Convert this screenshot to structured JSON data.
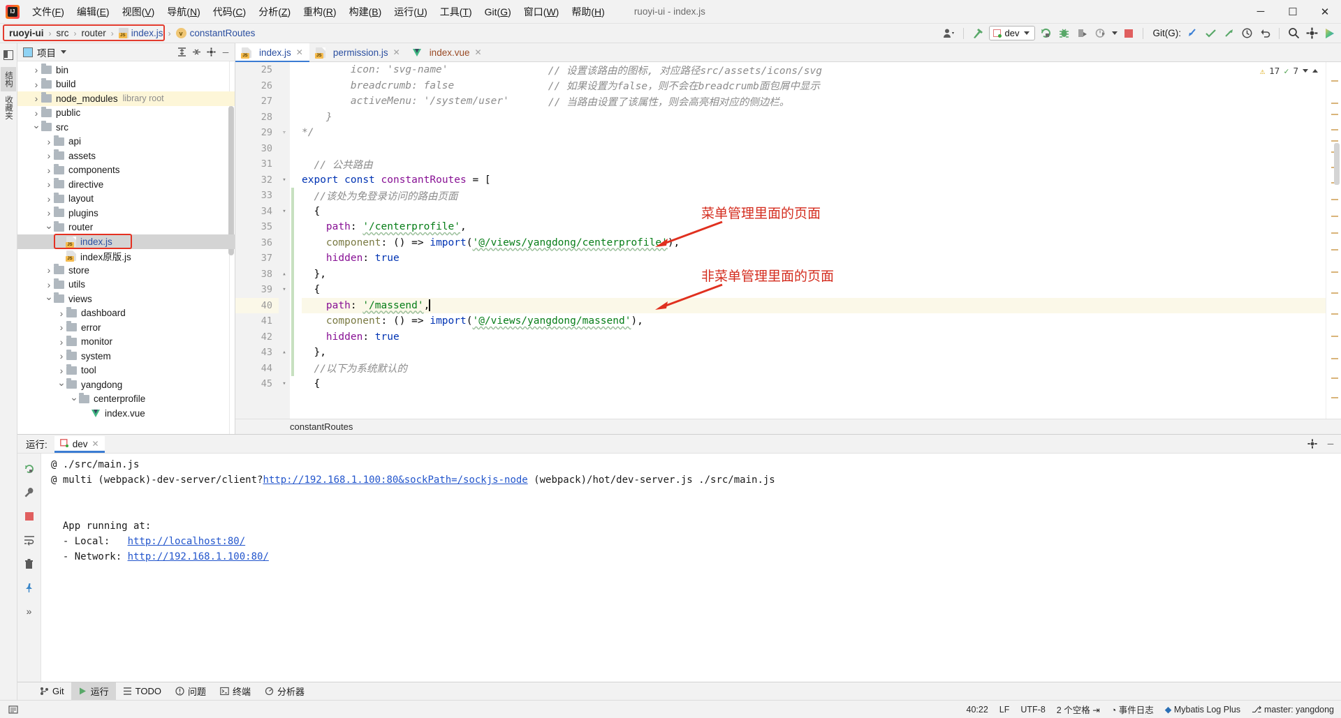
{
  "window": {
    "title": "ruoyi-ui - index.js",
    "minimize": "─",
    "maximize": "☐",
    "close": "✕"
  },
  "menu": [
    "文件(F)",
    "编辑(E)",
    "视图(V)",
    "导航(N)",
    "代码(C)",
    "分析(Z)",
    "重构(R)",
    "构建(B)",
    "运行(U)",
    "工具(T)",
    "Git(G)",
    "窗口(W)",
    "帮助(H)"
  ],
  "breadcrumb": {
    "items": [
      "ruoyi-ui",
      "src",
      "router",
      "index.js",
      "constantRoutes"
    ],
    "separator": "›"
  },
  "toolbar": {
    "run_config": "dev",
    "git_label": "Git(G):",
    "icons": [
      "user-avatar-icon",
      "build-hammer-icon",
      "run-icon",
      "debug-icon",
      "coverage-icon",
      "profile-icon",
      "stop-icon",
      "update-project-icon",
      "commit-icon",
      "push-icon",
      "history-icon",
      "rollback-icon",
      "search-everywhere-icon",
      "settings-icon",
      "idea-services-icon"
    ]
  },
  "left_tool_tabs": [
    "项目",
    "结构收藏夹"
  ],
  "project_panel": {
    "title": "项目",
    "actions": [
      "expand-all-icon",
      "collapse-all-icon",
      "settings-icon",
      "hide-icon"
    ],
    "tree": [
      {
        "label": "bin",
        "type": "folder",
        "indent": 1,
        "arrow": "collapsed",
        "state": ""
      },
      {
        "label": "build",
        "type": "folder",
        "indent": 1,
        "arrow": "collapsed",
        "state": ""
      },
      {
        "label": "node_modules",
        "type": "folder",
        "indent": 1,
        "arrow": "collapsed",
        "state": "yellow",
        "suffix": "library root"
      },
      {
        "label": "public",
        "type": "folder",
        "indent": 1,
        "arrow": "collapsed",
        "state": ""
      },
      {
        "label": "src",
        "type": "folder",
        "indent": 1,
        "arrow": "expanded",
        "state": ""
      },
      {
        "label": "api",
        "type": "folder",
        "indent": 2,
        "arrow": "collapsed",
        "state": ""
      },
      {
        "label": "assets",
        "type": "folder",
        "indent": 2,
        "arrow": "collapsed",
        "state": ""
      },
      {
        "label": "components",
        "type": "folder",
        "indent": 2,
        "arrow": "collapsed",
        "state": ""
      },
      {
        "label": "directive",
        "type": "folder",
        "indent": 2,
        "arrow": "collapsed",
        "state": ""
      },
      {
        "label": "layout",
        "type": "folder",
        "indent": 2,
        "arrow": "collapsed",
        "state": ""
      },
      {
        "label": "plugins",
        "type": "folder",
        "indent": 2,
        "arrow": "collapsed",
        "state": ""
      },
      {
        "label": "router",
        "type": "folder",
        "indent": 2,
        "arrow": "expanded",
        "state": ""
      },
      {
        "label": "index.js",
        "type": "js",
        "indent": 3,
        "arrow": "none",
        "state": "selected"
      },
      {
        "label": "index原版.js",
        "type": "js",
        "indent": 3,
        "arrow": "none",
        "state": ""
      },
      {
        "label": "store",
        "type": "folder",
        "indent": 2,
        "arrow": "collapsed",
        "state": ""
      },
      {
        "label": "utils",
        "type": "folder",
        "indent": 2,
        "arrow": "collapsed",
        "state": ""
      },
      {
        "label": "views",
        "type": "folder",
        "indent": 2,
        "arrow": "expanded",
        "state": ""
      },
      {
        "label": "dashboard",
        "type": "folder",
        "indent": 3,
        "arrow": "collapsed",
        "state": ""
      },
      {
        "label": "error",
        "type": "folder",
        "indent": 3,
        "arrow": "collapsed",
        "state": ""
      },
      {
        "label": "monitor",
        "type": "folder",
        "indent": 3,
        "arrow": "collapsed",
        "state": ""
      },
      {
        "label": "system",
        "type": "folder",
        "indent": 3,
        "arrow": "collapsed",
        "state": ""
      },
      {
        "label": "tool",
        "type": "folder",
        "indent": 3,
        "arrow": "collapsed",
        "state": ""
      },
      {
        "label": "yangdong",
        "type": "folder",
        "indent": 3,
        "arrow": "expanded",
        "state": ""
      },
      {
        "label": "centerprofile",
        "type": "folder",
        "indent": 4,
        "arrow": "expanded",
        "state": ""
      },
      {
        "label": "index.vue",
        "type": "vue",
        "indent": 5,
        "arrow": "none",
        "state": ""
      }
    ]
  },
  "editor": {
    "tabs": [
      {
        "label": "index.js",
        "type": "js",
        "active": true
      },
      {
        "label": "permission.js",
        "type": "js",
        "active": false
      },
      {
        "label": "index.vue",
        "type": "vue",
        "active": false
      }
    ],
    "first_line_number": 25,
    "current_line": 40,
    "status_breadcrumb": "constantRoutes",
    "inspection": {
      "warnings": "17",
      "weak_warnings": "7"
    },
    "lines": [
      {
        "n": 25,
        "indent": 4,
        "tokens": [
          {
            "t": "icon: 'svg-name'",
            "c": "k-cm"
          }
        ],
        "comment": "// 设置该路由的图标, 对应路径src/assets/icons/svg"
      },
      {
        "n": 26,
        "indent": 4,
        "tokens": [
          {
            "t": "breadcrumb: false",
            "c": "k-cm"
          }
        ],
        "comment": "// 如果设置为false，则不会在breadcrumb面包屑中显示"
      },
      {
        "n": 27,
        "indent": 4,
        "tokens": [
          {
            "t": "activeMenu: '/system/user'",
            "c": "k-cm"
          }
        ],
        "comment": "// 当路由设置了该属性，则会高亮相对应的侧边栏。"
      },
      {
        "n": 28,
        "indent": 2,
        "tokens": [
          {
            "t": "}",
            "c": "k-cm"
          }
        ],
        "comment": ""
      },
      {
        "n": 29,
        "indent": 0,
        "tokens": [
          {
            "t": "*/",
            "c": "k-cm"
          }
        ],
        "comment": ""
      },
      {
        "n": 30,
        "indent": 0,
        "tokens": [],
        "comment": ""
      },
      {
        "n": 31,
        "indent": 1,
        "tokens": [
          {
            "t": "// 公共路由",
            "c": "k-cm"
          }
        ],
        "comment": ""
      },
      {
        "n": 32,
        "indent": 0,
        "tokens": [
          {
            "t": "export",
            "c": "k-kw"
          },
          {
            "t": " ",
            "c": "k-pl"
          },
          {
            "t": "const",
            "c": "k-kw"
          },
          {
            "t": " ",
            "c": "k-pl"
          },
          {
            "t": "constantRoutes",
            "c": "k-cls"
          },
          {
            "t": " = [",
            "c": "k-pl"
          }
        ],
        "comment": ""
      },
      {
        "n": 33,
        "indent": 1,
        "tokens": [
          {
            "t": "//该处为免登录访问的路由页面",
            "c": "k-cm"
          }
        ],
        "comment": ""
      },
      {
        "n": 34,
        "indent": 1,
        "tokens": [
          {
            "t": "{",
            "c": "k-pl"
          }
        ],
        "comment": ""
      },
      {
        "n": 35,
        "indent": 2,
        "tokens": [
          {
            "t": "path",
            "c": "k-prop"
          },
          {
            "t": ": ",
            "c": "k-pl"
          },
          {
            "t": "'/centerprofile'",
            "c": "k-str wavy"
          },
          {
            "t": ",",
            "c": "k-pl"
          }
        ],
        "comment": ""
      },
      {
        "n": 36,
        "indent": 2,
        "tokens": [
          {
            "t": "component",
            "c": "k-fn"
          },
          {
            "t": ": () => ",
            "c": "k-pl"
          },
          {
            "t": "import",
            "c": "k-kw"
          },
          {
            "t": "(",
            "c": "k-pl"
          },
          {
            "t": "'@/views/yangdong/centerprofile'",
            "c": "k-str wavy"
          },
          {
            "t": "),",
            "c": "k-pl"
          }
        ],
        "comment": ""
      },
      {
        "n": 37,
        "indent": 2,
        "tokens": [
          {
            "t": "hidden",
            "c": "k-prop"
          },
          {
            "t": ": ",
            "c": "k-pl"
          },
          {
            "t": "true",
            "c": "k-kw"
          }
        ],
        "comment": ""
      },
      {
        "n": 38,
        "indent": 1,
        "tokens": [
          {
            "t": "},",
            "c": "k-pl"
          }
        ],
        "comment": ""
      },
      {
        "n": 39,
        "indent": 1,
        "tokens": [
          {
            "t": "{",
            "c": "k-pl"
          }
        ],
        "comment": ""
      },
      {
        "n": 40,
        "indent": 2,
        "tokens": [
          {
            "t": "path",
            "c": "k-prop"
          },
          {
            "t": ": ",
            "c": "k-pl"
          },
          {
            "t": "'/massend'",
            "c": "k-str wavy"
          },
          {
            "t": ",",
            "c": "k-pl"
          }
        ],
        "comment": "",
        "caret": true
      },
      {
        "n": 41,
        "indent": 2,
        "tokens": [
          {
            "t": "component",
            "c": "k-fn"
          },
          {
            "t": ": () => ",
            "c": "k-pl"
          },
          {
            "t": "import",
            "c": "k-kw"
          },
          {
            "t": "(",
            "c": "k-pl"
          },
          {
            "t": "'@/views/yangdong/massend'",
            "c": "k-str wavy"
          },
          {
            "t": "),",
            "c": "k-pl"
          }
        ],
        "comment": ""
      },
      {
        "n": 42,
        "indent": 2,
        "tokens": [
          {
            "t": "hidden",
            "c": "k-prop"
          },
          {
            "t": ": ",
            "c": "k-pl"
          },
          {
            "t": "true",
            "c": "k-kw"
          }
        ],
        "comment": ""
      },
      {
        "n": 43,
        "indent": 1,
        "tokens": [
          {
            "t": "},",
            "c": "k-pl"
          }
        ],
        "comment": ""
      },
      {
        "n": 44,
        "indent": 1,
        "tokens": [
          {
            "t": "//以下为系统默认的",
            "c": "k-cm"
          }
        ],
        "comment": ""
      },
      {
        "n": 45,
        "indent": 1,
        "tokens": [
          {
            "t": "{",
            "c": "k-pl"
          }
        ],
        "comment": ""
      }
    ],
    "annotations": [
      {
        "text": "菜单管理里面的页面",
        "target_line": 36
      },
      {
        "text": "非菜单管理里面的页面",
        "target_line": 40
      }
    ]
  },
  "run_panel": {
    "label": "运行:",
    "tab": "dev",
    "tools": [
      "rerun-icon",
      "wrench-icon",
      "stop-icon",
      "soft-wrap-icon",
      "trash-icon",
      "pin-icon",
      "expand-icon"
    ],
    "console_lines": [
      {
        "parts": [
          {
            "t": "@ ./src/main.js",
            "link": false
          }
        ]
      },
      {
        "parts": [
          {
            "t": "@ multi (webpack)-dev-server/client?",
            "link": false
          },
          {
            "t": "http://192.168.1.100:80&sockPath=/sockjs-node",
            "link": true
          },
          {
            "t": " (webpack)/hot/dev-server.js ./src/main.js",
            "link": false
          }
        ]
      },
      {
        "parts": [
          {
            "t": "",
            "link": false
          }
        ]
      },
      {
        "parts": [
          {
            "t": "",
            "link": false
          }
        ]
      },
      {
        "parts": [
          {
            "t": "  App running at:",
            "link": false
          }
        ]
      },
      {
        "parts": [
          {
            "t": "  - Local:   ",
            "link": false
          },
          {
            "t": "http://localhost:80/",
            "link": true
          }
        ]
      },
      {
        "parts": [
          {
            "t": "  - Network: ",
            "link": false
          },
          {
            "t": "http://192.168.1.100:80/",
            "link": true
          }
        ]
      }
    ]
  },
  "tool_windows": [
    {
      "label": "Git",
      "icon": "git-branch-icon",
      "selected": false
    },
    {
      "label": "运行",
      "icon": "run-icon",
      "selected": true
    },
    {
      "label": "TODO",
      "icon": "todo-icon",
      "selected": false
    },
    {
      "label": "问题",
      "icon": "problems-icon",
      "selected": false
    },
    {
      "label": "终端",
      "icon": "terminal-icon",
      "selected": false
    },
    {
      "label": "分析器",
      "icon": "profiler-icon",
      "selected": false
    }
  ],
  "status_bar": {
    "left_icon": "event-log-icon",
    "right": [
      {
        "label": "40:22",
        "name": "caret-position"
      },
      {
        "label": "LF",
        "name": "line-separator"
      },
      {
        "label": "UTF-8",
        "name": "file-encoding"
      },
      {
        "label": "2 个空格",
        "name": "indent-setting"
      },
      {
        "label": "事件日志",
        "name": "event-log"
      },
      {
        "label": "Mybatis Log Plus",
        "name": "mybatis-log-plus"
      },
      {
        "label": "master: yangdong",
        "name": "git-branch"
      }
    ]
  }
}
